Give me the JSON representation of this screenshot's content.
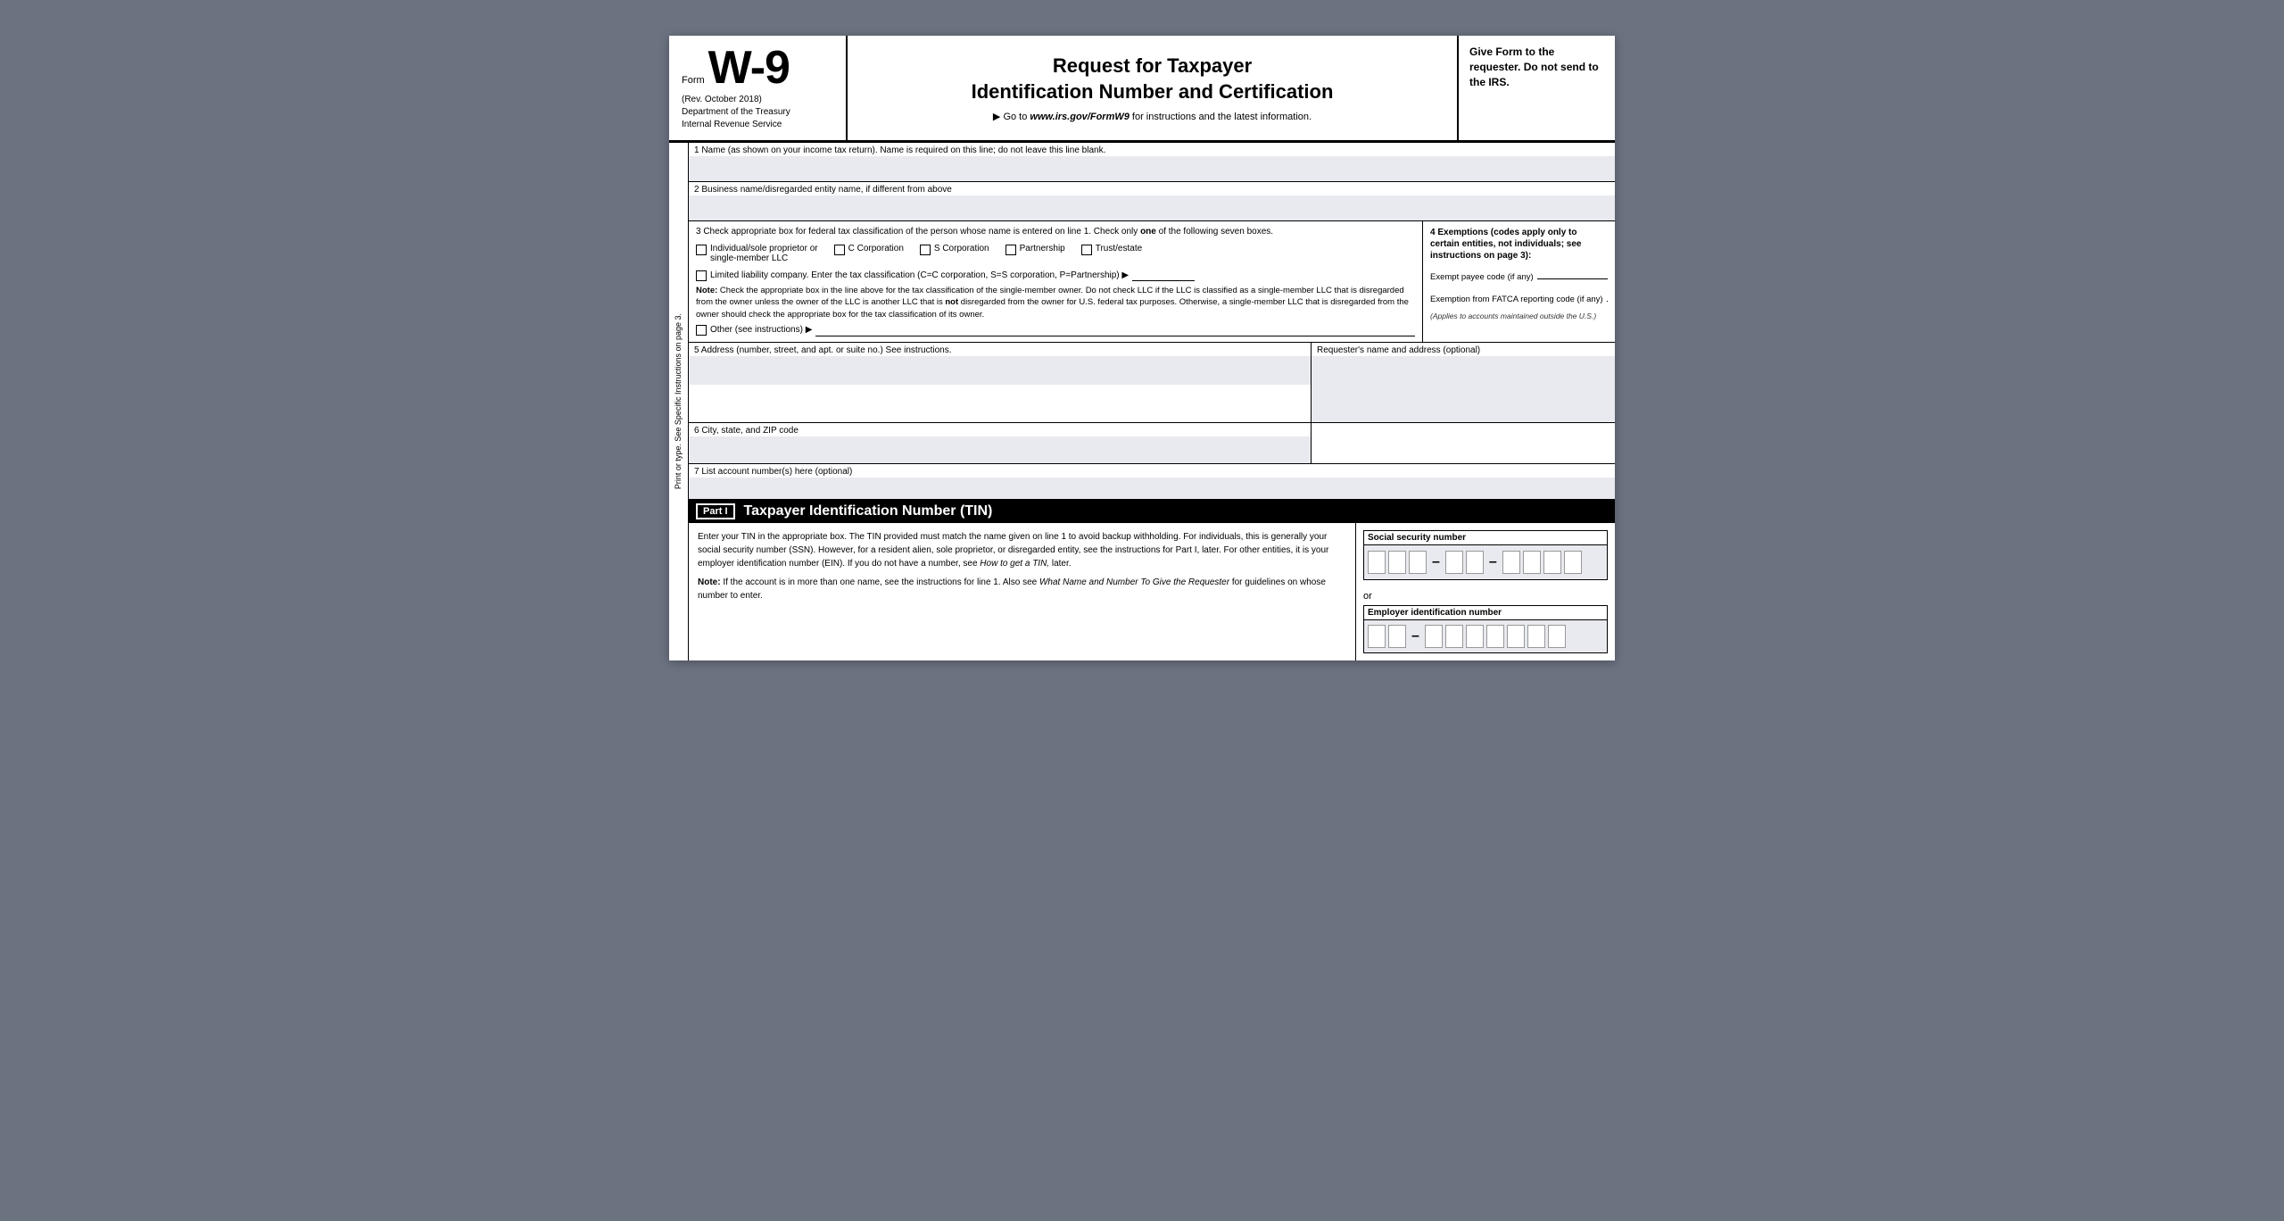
{
  "header": {
    "form_word": "Form",
    "form_number": "W-9",
    "rev": "(Rev. October 2018)",
    "dept1": "Department of the Treasury",
    "dept2": "Internal Revenue Service",
    "title_line1": "Request for Taxpayer",
    "title_line2": "Identification Number and Certification",
    "goto": "▶ Go to www.irs.gov/FormW9 for instructions and the latest information.",
    "goto_url": "www.irs.gov/FormW9",
    "give_form": "Give Form to the requester. Do not send to the IRS."
  },
  "fields": {
    "line1_label": "1  Name (as shown on your income tax return). Name is required on this line; do not leave this line blank.",
    "line2_label": "2  Business name/disregarded entity name, if different from above",
    "line3_label_start": "3  Check appropriate box for federal tax classification of the person whose name is entered on line 1. Check only ",
    "line3_label_one": "one",
    "line3_label_end": " of the following seven boxes.",
    "checkboxes": [
      {
        "id": "indiv",
        "label": "Individual/sole proprietor or\nsingle-member LLC"
      },
      {
        "id": "c_corp",
        "label": "C Corporation"
      },
      {
        "id": "s_corp",
        "label": "S Corporation"
      },
      {
        "id": "partner",
        "label": "Partnership"
      },
      {
        "id": "trust",
        "label": "Trust/estate"
      }
    ],
    "llc_label": "Limited liability company. Enter the tax classification (C=C corporation, S=S corporation, P=Partnership) ▶",
    "note_label": "Note:",
    "note_text": " Check the appropriate box in the line above for the tax classification of the single-member owner.  Do not check LLC if the LLC is classified as a single-member LLC that is disregarded from the owner unless the owner of the LLC is another LLC that is ",
    "note_not": "not",
    "note_text2": " disregarded from the owner for U.S. federal tax purposes. Otherwise, a single-member LLC that is disregarded from the owner should check the appropriate box for the tax classification of its owner.",
    "other_label": "Other (see instructions) ▶",
    "exemptions_title": "4  Exemptions (codes apply only to certain entities, not individuals; see instructions on page 3):",
    "exempt_payee_label": "Exempt payee code (if any)",
    "fatca_label": "Exemption from FATCA reporting code (if any)",
    "fatca_applies": "(Applies to accounts maintained outside the U.S.)",
    "line5_label": "5  Address (number, street, and apt. or suite no.) See instructions.",
    "requester_label": "Requester's name and address (optional)",
    "line6_label": "6  City, state, and ZIP code",
    "line7_label": "7  List account number(s) here (optional)",
    "side_text": "Print or type.    See Specific Instructions on page 3.",
    "part1_label": "Part I",
    "part1_title": "Taxpayer Identification Number (TIN)",
    "part1_body1": "Enter your TIN in the appropriate box. The TIN provided must match the name given on line 1 to avoid backup withholding. For individuals, this is generally your social security number (SSN). However, for a resident alien, sole proprietor, or disregarded entity, see the instructions for Part I, later. For other entities, it is your employer identification number (EIN). If you do not have a number, see ",
    "part1_body1_italic": "How to get a TIN,",
    "part1_body1_end": " later.",
    "part1_note_start": "Note:",
    "part1_note_text": " If the account is in more than one name, see the instructions for line 1. Also see ",
    "part1_note_italic": "What Name and Number To Give the Requester",
    "part1_note_end": " for guidelines on whose number to enter.",
    "ssn_label": "Social security number",
    "or_text": "or",
    "ein_label": "Employer identification number"
  }
}
